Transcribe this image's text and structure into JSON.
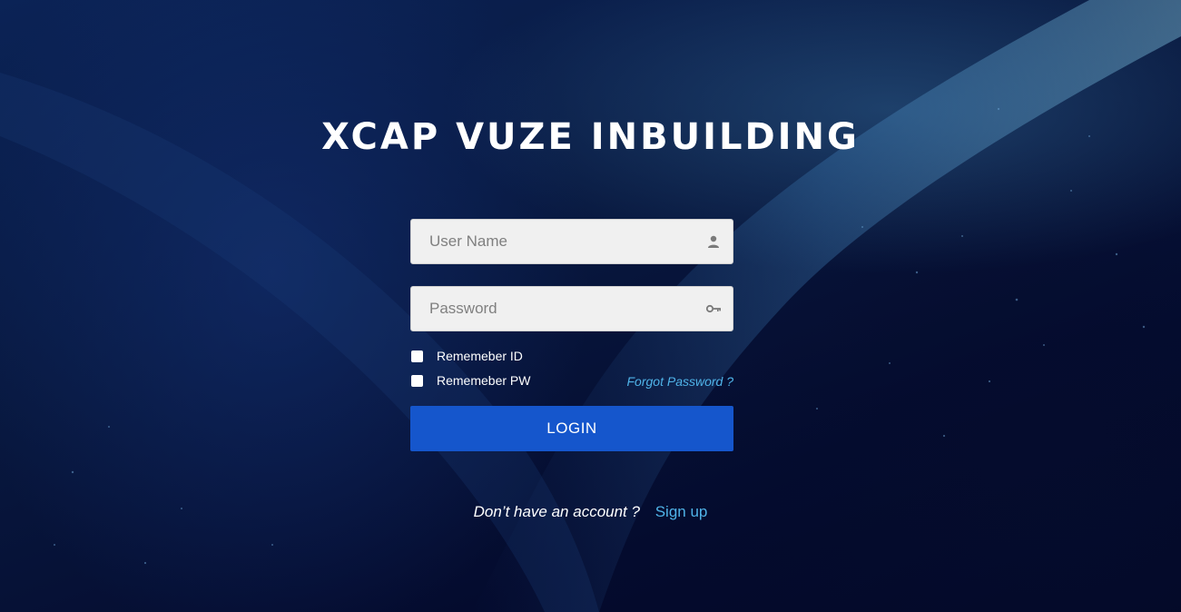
{
  "brand": {
    "title": "XCAP VUZE INBUILDING"
  },
  "form": {
    "username_placeholder": "User Name",
    "password_placeholder": "Password",
    "remember_id_label": "Rememeber ID",
    "remember_pw_label": "Rememeber PW",
    "forgot_password": "Forgot Password ?",
    "login_label": "LOGIN",
    "remember_id_checked": false,
    "remember_pw_checked": false
  },
  "signup": {
    "question": "Don’t have an account ?",
    "link": "Sign up"
  },
  "icons": {
    "username": "user-icon",
    "password": "key-icon"
  },
  "colors": {
    "background": "#040b2e",
    "button": "#1556cc",
    "link": "#4fb3e8",
    "field": "#f0f0f0"
  }
}
